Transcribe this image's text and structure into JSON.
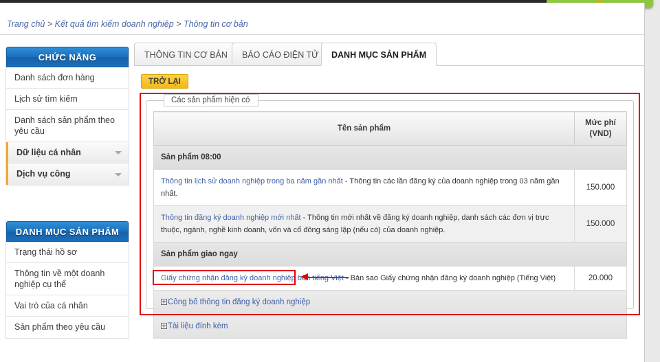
{
  "breadcrumb": {
    "items": [
      "Trang chủ",
      "Kết quả tìm kiếm doanh nghiệp",
      "Thông tin cơ bản"
    ],
    "separator": ">"
  },
  "sidebar": {
    "panels": [
      {
        "title": "CHỨC NĂNG",
        "items": [
          {
            "label": "Danh sách đơn hàng",
            "expandable": false
          },
          {
            "label": "Lịch sử tìm kiếm",
            "expandable": false
          },
          {
            "label": "Danh sách sản phẩm theo yêu cầu",
            "expandable": false
          },
          {
            "label": "Dữ liệu cá nhân",
            "expandable": true
          },
          {
            "label": "Dịch vụ công",
            "expandable": true
          }
        ]
      },
      {
        "title": "DANH MỤC SẢN PHẨM",
        "items": [
          {
            "label": "Trạng thái hồ sơ",
            "expandable": false
          },
          {
            "label": "Thông tin về một doanh nghiệp cụ thể",
            "expandable": false
          },
          {
            "label": "Vai trò của cá nhân",
            "expandable": false
          },
          {
            "label": "Sản phẩm theo yêu cầu",
            "expandable": false
          }
        ]
      }
    ]
  },
  "tabs": [
    {
      "label": "THÔNG TIN CƠ BẢN",
      "active": false
    },
    {
      "label": "BÁO CÁO ĐIỆN TỬ",
      "active": false
    },
    {
      "label": "DANH MỤC SẢN PHẨM",
      "active": true
    }
  ],
  "toolbar": {
    "back_label": "TRỞ LẠI"
  },
  "panel": {
    "legend": "Các sản phẩm hiện có"
  },
  "table": {
    "headers": {
      "name": "Tên sản phẩm",
      "fee_line1": "Mức phí",
      "fee_line2": "(VND)"
    },
    "groups": [
      {
        "title": "Sản phẩm 08:00",
        "rows": [
          {
            "name": "Thông tin lịch sử doanh nghiệp trong ba năm gần nhất",
            "desc": "- Thông tin các lần đăng ký của doanh nghiệp trong 03 năm gần nhất.",
            "fee": "150.000"
          },
          {
            "name": "Thông tin đăng ký doanh nghiệp mới nhất",
            "desc": "- Thông tin mới nhất về đăng ký doanh nghiệp, danh sách các đơn vị trực thuộc, ngành, nghề kinh doanh, vốn và cổ đông sáng lập (nếu có) của doanh nghiệp.",
            "fee": "150.000"
          }
        ]
      },
      {
        "title": "Sản phẩm giao ngay",
        "rows": [
          {
            "name": "Giấy chứng nhận đăng ký doanh nghiệp bản tiếng Việt",
            "desc": "- Bản sao Giấy chứng nhận đăng ký doanh nghiệp (Tiếng Việt)",
            "fee": "20.000"
          }
        ]
      }
    ],
    "expandables": [
      {
        "label": "Công bố thông tin đăng ký doanh nghiệp",
        "highlighted": true
      },
      {
        "label": "Tài liệu đính kèm",
        "highlighted": false
      }
    ]
  },
  "annotation": {
    "highlight_color": "#e00000",
    "arrow_direction": "left"
  },
  "theme": {
    "accent_blue": "#1c6fbb",
    "link_blue": "#3f5fa8",
    "button_yellow": "#f0b81c",
    "green_tab": "#8dc63f",
    "sidebar_marker": "#f0a830"
  }
}
